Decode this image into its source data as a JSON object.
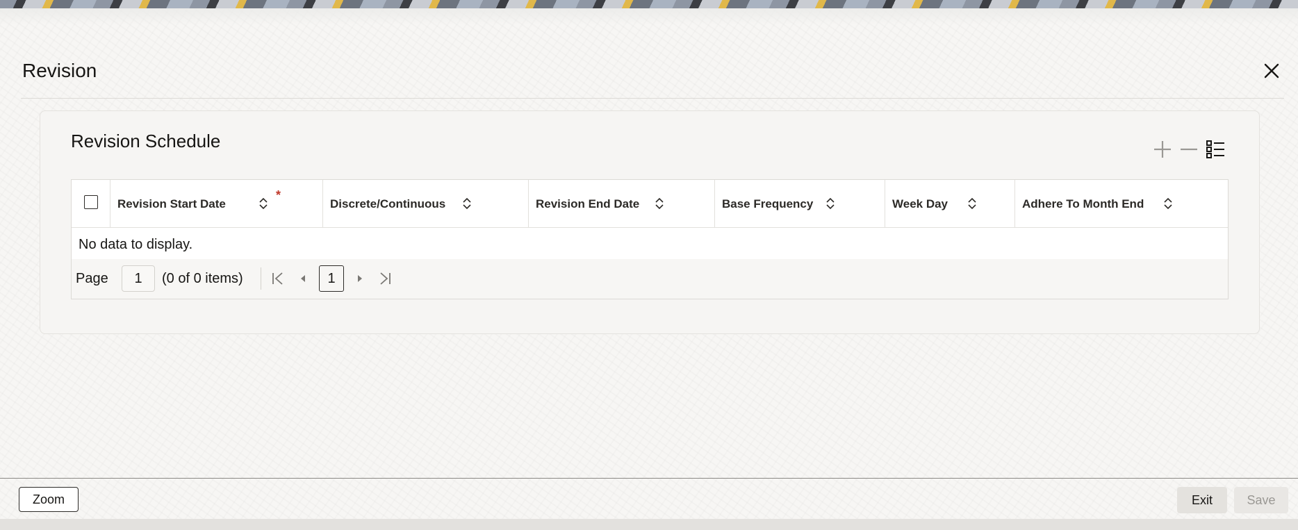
{
  "page": {
    "title": "Revision",
    "close_icon": "close-icon"
  },
  "section": {
    "title": "Revision Schedule",
    "toolbar": {
      "add_icon": "plus-icon",
      "remove_icon": "minus-icon",
      "columns_icon": "column-list-icon"
    }
  },
  "grid": {
    "select_all_checked": false,
    "columns": [
      {
        "label": "Revision Start Date",
        "required": true,
        "sortable": true
      },
      {
        "label": "Discrete/Continuous",
        "sortable": true
      },
      {
        "label": "Revision End Date",
        "sortable": true
      },
      {
        "label": "Base Frequency",
        "sortable": true
      },
      {
        "label": "Week Day",
        "sortable": true
      },
      {
        "label": "Adhere To Month End",
        "sortable": true
      }
    ],
    "rows": [],
    "empty_message": "No data to display."
  },
  "pager": {
    "page_label": "Page",
    "page_value": "1",
    "count_text": "(0 of 0 items)",
    "current_page": "1"
  },
  "footer": {
    "zoom_label": "Zoom",
    "exit_label": "Exit",
    "save_label": "Save"
  },
  "colors": {
    "required": "#c0392b",
    "text": "#161513",
    "disabled_text": "#9a9894"
  }
}
